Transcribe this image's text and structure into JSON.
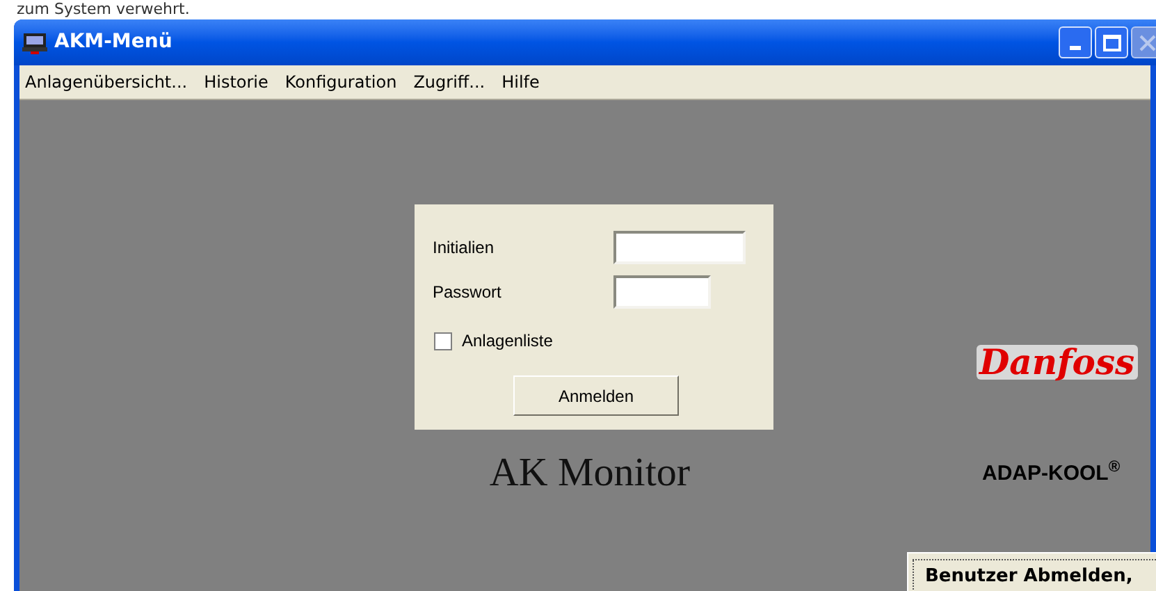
{
  "caption_above": "zum System verwehrt.",
  "window": {
    "title": "AKM-Menü"
  },
  "menu": [
    "Anlagenübersicht...",
    "Historie",
    "Konfiguration",
    "Zugriff...",
    "Hilfe"
  ],
  "login": {
    "fields": [
      {
        "label": "Initialien"
      },
      {
        "label": "Passwort"
      }
    ],
    "checkbox": {
      "label": "Anlagenliste",
      "checked": false
    },
    "button": "Anmelden"
  },
  "app_title": "AK Monitor",
  "brand": {
    "logo": "Danfoss",
    "product": "ADAP-KOOL$^{®}$"
  },
  "logout_button": "Benutzer Abmelden,"
}
